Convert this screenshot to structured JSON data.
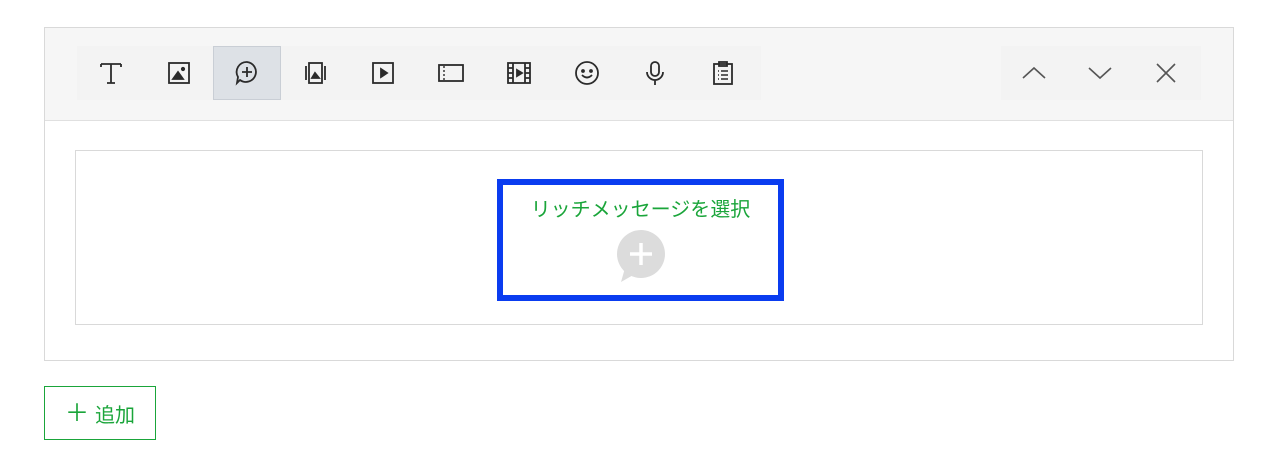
{
  "toolbar": {
    "tools": [
      {
        "name": "text-tool",
        "icon": "text-icon"
      },
      {
        "name": "image-tool",
        "icon": "image-icon"
      },
      {
        "name": "rich-message-tool",
        "icon": "chat-plus-icon",
        "active": true
      },
      {
        "name": "card-message-tool",
        "icon": "card-carousel-icon"
      },
      {
        "name": "video-tool",
        "icon": "play-icon"
      },
      {
        "name": "coupon-tool",
        "icon": "coupon-icon"
      },
      {
        "name": "rich-video-tool",
        "icon": "film-icon"
      },
      {
        "name": "sticker-tool",
        "icon": "smiley-icon"
      },
      {
        "name": "audio-tool",
        "icon": "microphone-icon"
      },
      {
        "name": "survey-tool",
        "icon": "clipboard-icon"
      }
    ],
    "nav": [
      "move-up-icon",
      "move-down-icon",
      "close-icon"
    ]
  },
  "content": {
    "rich_message_label": "リッチメッセージを選択"
  },
  "footer": {
    "add_plus": "＋",
    "add_label": "追加"
  },
  "colors": {
    "accent_green": "#1aa53a",
    "highlight_blue": "#0a3cf0",
    "icon_gray": "#2b2b2b"
  }
}
